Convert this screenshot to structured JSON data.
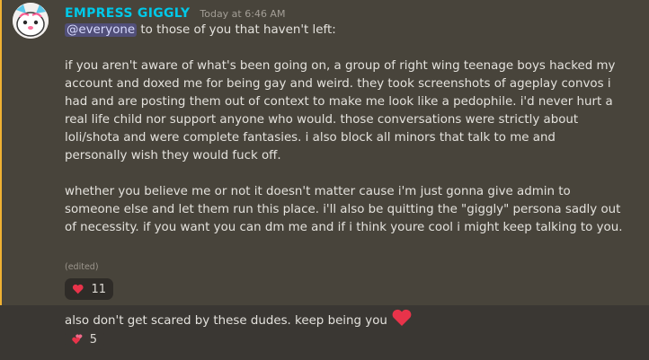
{
  "message": {
    "username": "EMPRESS GIGGLY",
    "timestamp": "Today at 6:46 AM",
    "mention": "@everyone",
    "first_line_rest": " to those of you that haven't left:",
    "paragraph1": [
      "if you aren't aware of what's been going on, a group of right wing teenage boys hacked my",
      "account and doxed me for being gay and weird. they took screenshots of ageplay convos i",
      "had and are posting them out of context to make me look like a pedophile. i'd never hurt a",
      "real life child nor support anyone who would. those conversations were strictly about",
      "loli/shota and were complete fantasies. i also block all minors that talk to me and",
      "personally wish they would fuck off."
    ],
    "paragraph2": [
      "whether you believe me or not it doesn't matter cause i'm just gonna give admin to",
      "someone else and let them run this place. i'll also be quitting the \"giggly\" persona sadly out",
      "of necessity. if you want you can dm me and if i think youre cool i might keep talking to you."
    ],
    "edited_label": "(edited)",
    "reaction": {
      "emoji": "heart-icon",
      "count": "11"
    }
  },
  "followup": {
    "text": "also don't get scared by these dudes. keep being you",
    "emoji": "heart-icon",
    "reaction": {
      "emoji": "two-hearts-icon",
      "count": "5"
    }
  },
  "colors": {
    "username": "#00c8e8",
    "highlight_bg": "#48443b",
    "highlight_bar": "#f0b232",
    "mention_bg": "#514f79",
    "heart": "#e8334a"
  }
}
